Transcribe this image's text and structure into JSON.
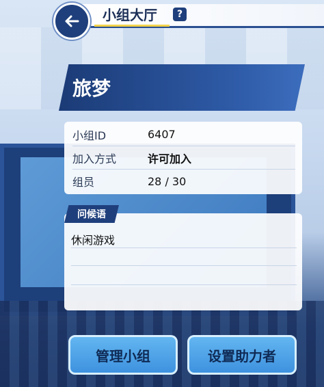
{
  "header": {
    "title": "小组大厅",
    "help": "?"
  },
  "group": {
    "name": "旅梦",
    "fields": [
      {
        "label": "小组ID",
        "value": "6407"
      },
      {
        "label": "加入方式",
        "value": "许可加入"
      },
      {
        "label": "组员",
        "value": "28 / 30"
      }
    ]
  },
  "greeting": {
    "tag": "问候语",
    "text": "休闲游戏"
  },
  "buttons": {
    "manage": "管理小组",
    "assist": "设置助力者"
  },
  "colors": {
    "accent": "#1f3f7c",
    "button": "#3e92df",
    "highlight": "#f2d34a"
  }
}
